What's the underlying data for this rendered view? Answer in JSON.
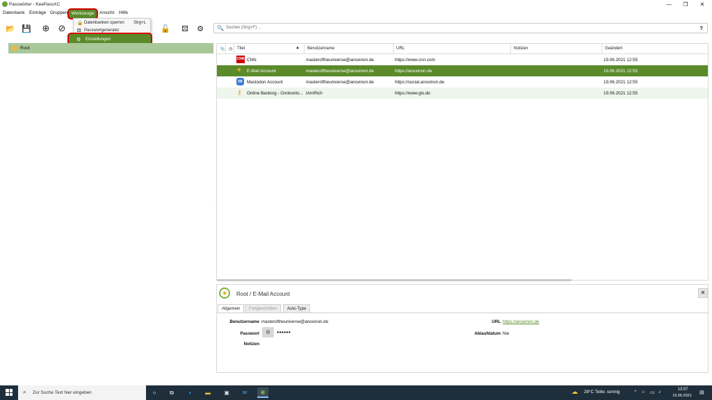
{
  "window": {
    "title": "Passwörter - KeePassXC",
    "minimize": "—",
    "maximize": "❐",
    "close": "✕"
  },
  "menubar": {
    "datenbank": "Datenbank",
    "eintraege": "Einträge",
    "gruppen": "Gruppen",
    "werkzeuge": "Werkzeuge",
    "ansicht": "Ansicht",
    "hilfe": "Hilfe"
  },
  "dropdown": {
    "items": [
      {
        "label": "Datenbanken sperren",
        "shortcut": "Strg+L",
        "icon": "lock-icon"
      },
      {
        "label": "Passwortgenerator",
        "icon": "dice-icon"
      },
      {
        "label": "Einstellungen",
        "icon": "gear-icon",
        "highlighted": true
      }
    ]
  },
  "search": {
    "placeholder": "Suchen (Strg+F) ...",
    "help": "?"
  },
  "tree": {
    "root": "Root"
  },
  "table": {
    "headers": {
      "title": "Titel",
      "username": "Benutzername",
      "url": "URL",
      "notes": "Notizen",
      "modified": "Geändert"
    },
    "rows": [
      {
        "title": "CNN",
        "username": "masteroftheuniverse@anoxinon.de",
        "url": "https://www.cnn.com",
        "notes": "",
        "modified": "19.06.2021 12:55",
        "icon": "cnn-icon",
        "selected": false
      },
      {
        "title": "E-Mail Account",
        "username": "masteroftheuniverse@anoxinon.de",
        "url": "https://anoxinon.de",
        "notes": "",
        "modified": "19.06.2021 12:55",
        "icon": "email-icon",
        "selected": true
      },
      {
        "title": "Mastodon Account",
        "username": "masteroftheuniverse@anoxinon.de",
        "url": "https://social.anoxinon.de",
        "notes": "",
        "modified": "19.06.2021 12:55",
        "icon": "mastodon-icon",
        "selected": false
      },
      {
        "title": "Online Banking - Girokonto...",
        "username": "IAmRich",
        "url": "https://www.gls.de",
        "notes": "",
        "modified": "19.06.2021 12:55",
        "icon": "key-icon",
        "selected": false
      }
    ]
  },
  "details": {
    "title": "Root / E-Mail Account",
    "tabs": [
      "Allgemein",
      "Fortgeschritten",
      "Auto-Type"
    ],
    "labels": {
      "username": "Benutzername",
      "password": "Passwort",
      "notes": "Notizen",
      "url": "URL",
      "expiry": "Ablaufdatum"
    },
    "values": {
      "username": "masteroftheuniverse@anoxinon.de",
      "password": "●●●●●●",
      "url": "https://anoxinon.de",
      "expiry": "Nie"
    }
  },
  "taskbar": {
    "search_placeholder": "Zur Suche Text hier eingeben",
    "weather": "28°C  Teilw. sonnig",
    "time": "13:07",
    "date": "19.06.2021"
  },
  "colors": {
    "accent": "#5a8a2a",
    "selected_row": "#5a8a2a",
    "tree_selected": "#a9c89a",
    "highlight_border": "#d40000",
    "row_alt": "#eef5ea"
  }
}
